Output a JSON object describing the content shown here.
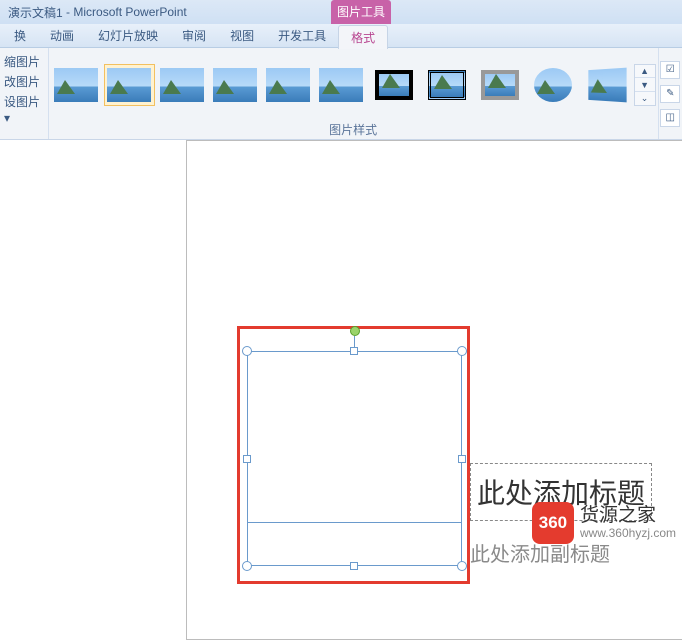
{
  "title_bar": {
    "document": "演示文稿1",
    "app": "Microsoft PowerPoint"
  },
  "contextual_tab": {
    "label": "图片工具"
  },
  "menu": {
    "items": [
      "换",
      "动画",
      "幻灯片放映",
      "审阅",
      "视图",
      "开发工具",
      "格式"
    ],
    "active_index": 6
  },
  "ribbon": {
    "left_group": [
      "缩图片",
      "改图片",
      "设图片 ▾"
    ],
    "group_label": "图片样式",
    "gallery_more": [
      "▲",
      "▼",
      "⌄"
    ],
    "right_buttons": [
      "☑",
      "✎",
      "◫"
    ]
  },
  "slide": {
    "title_placeholder": "此处添加标题",
    "subtitle_placeholder": "此处添加副标题"
  },
  "watermark": {
    "logo": "360",
    "name": "货源之家",
    "url": "www.360hyzj.com"
  }
}
